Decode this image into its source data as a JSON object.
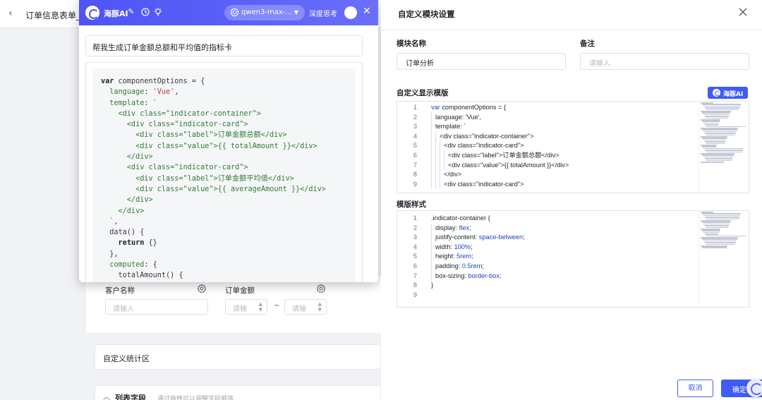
{
  "background": {
    "back_icon": "chevron-left-icon",
    "title": "订单信息表单_o",
    "fields": [
      {
        "label": "客户名称",
        "placeholder": "请输入"
      },
      {
        "label": "订单金额",
        "min_placeholder": "请输",
        "max_placeholder": "请输",
        "separator": "~"
      }
    ],
    "stats_section_title": "自定义统计区",
    "list_section_title": "列表字段",
    "list_section_hint": "通过拖拽可以调整字段顺序"
  },
  "ai_panel": {
    "name": "海豚AI",
    "header_icons": [
      "magic-wand-icon",
      "history-icon",
      "lightbulb-icon"
    ],
    "model": "qwen3-max-...",
    "deep_think_label": "深度思考",
    "prompt": "帮我生成订单金额总额和平均值的指标卡",
    "code_lines": [
      [
        {
          "t": "var",
          "c": "ck"
        },
        {
          "t": " componentOptions = {"
        }
      ],
      [
        {
          "t": "  "
        },
        {
          "t": "language",
          "c": "cp"
        },
        {
          "t": ": "
        },
        {
          "t": "'Vue'",
          "c": "cs"
        },
        {
          "t": ","
        }
      ],
      [
        {
          "t": "  "
        },
        {
          "t": "template",
          "c": "cp"
        },
        {
          "t": ": `"
        }
      ],
      [
        {
          "t": "    <div class=\"indicator-container\">",
          "c": "cp"
        }
      ],
      [
        {
          "t": "      <div class=\"indicator-card\">",
          "c": "cp"
        }
      ],
      [
        {
          "t": "        <div class=\"label\">订单金额总额</div>",
          "c": "cp"
        }
      ],
      [
        {
          "t": "        <div class=\"value\">{{ totalAmount }}</div>",
          "c": "cp"
        }
      ],
      [
        {
          "t": "      </div>",
          "c": "cp"
        }
      ],
      [
        {
          "t": "      <div class=\"indicator-card\">",
          "c": "cp"
        }
      ],
      [
        {
          "t": "        <div class=\"label\">订单金额平均值</div>",
          "c": "cp"
        }
      ],
      [
        {
          "t": "        <div class=\"value\">{{ averageAmount }}</div>",
          "c": "cp"
        }
      ],
      [
        {
          "t": "      </div>",
          "c": "cp"
        }
      ],
      [
        {
          "t": "    </div>",
          "c": "cp"
        }
      ],
      [
        {
          "t": "  `",
          "c": "cp"
        },
        {
          "t": ","
        }
      ],
      [
        {
          "t": "  data() {"
        }
      ],
      [
        {
          "t": "    "
        },
        {
          "t": "return",
          "c": "ck"
        },
        {
          "t": " {}"
        }
      ],
      [
        {
          "t": "  },"
        }
      ],
      [
        {
          "t": "  "
        },
        {
          "t": "computed",
          "c": "cp"
        },
        {
          "t": ": {"
        }
      ],
      [
        {
          "t": "    totalAmount() {"
        }
      ]
    ]
  },
  "settings": {
    "title": "自定义模块设置",
    "module_name_label": "模块名称",
    "module_name_value": "订单分析",
    "remark_label": "备注",
    "remark_placeholder": "请输入",
    "template_label": "自定义显示模版",
    "ai_button_label": "海豚AI",
    "style_label": "模版样式",
    "template_lines": [
      {
        "n": "1",
        "indent": 0,
        "parts": [
          {
            "t": "var",
            "c": "ks"
          },
          {
            "t": " componentOptions = {"
          }
        ]
      },
      {
        "n": "2",
        "indent": 1,
        "parts": [
          {
            "t": "language: 'Vue',"
          }
        ]
      },
      {
        "n": "3",
        "indent": 1,
        "parts": [
          {
            "t": "template: `"
          }
        ]
      },
      {
        "n": "4",
        "indent": 2,
        "parts": [
          {
            "t": "<div class=\"indicator-container\">"
          }
        ]
      },
      {
        "n": "5",
        "indent": 3,
        "parts": [
          {
            "t": "<div class=\"indicator-card\">"
          }
        ]
      },
      {
        "n": "6",
        "indent": 4,
        "parts": [
          {
            "t": "<div class=\"label\">订单金额总额</div>"
          }
        ]
      },
      {
        "n": "7",
        "indent": 4,
        "parts": [
          {
            "t": "<div class=\"value\">{{ totalAmount }}</div>"
          }
        ]
      },
      {
        "n": "8",
        "indent": 3,
        "parts": [
          {
            "t": "</div>"
          }
        ]
      },
      {
        "n": "9",
        "indent": 3,
        "parts": [
          {
            "t": "<div class=\"indicator-card\">"
          }
        ]
      }
    ],
    "style_lines": [
      {
        "n": "1",
        "indent": 0,
        "parts": [
          {
            "t": ".indicator-container {"
          }
        ]
      },
      {
        "n": "2",
        "indent": 1,
        "parts": [
          {
            "t": "display"
          },
          {
            "t": ": "
          },
          {
            "t": "flex",
            "c": "vs"
          },
          {
            "t": ";"
          }
        ]
      },
      {
        "n": "3",
        "indent": 1,
        "parts": [
          {
            "t": "justify-content"
          },
          {
            "t": ": "
          },
          {
            "t": "space-between",
            "c": "vs"
          },
          {
            "t": ";"
          }
        ]
      },
      {
        "n": "4",
        "indent": 1,
        "parts": [
          {
            "t": "width"
          },
          {
            "t": ": "
          },
          {
            "t": "100%",
            "c": "vs"
          },
          {
            "t": ";"
          }
        ]
      },
      {
        "n": "5",
        "indent": 1,
        "parts": [
          {
            "t": "height"
          },
          {
            "t": ": "
          },
          {
            "t": "5rem",
            "c": "vs"
          },
          {
            "t": ";"
          }
        ]
      },
      {
        "n": "6",
        "indent": 1,
        "parts": [
          {
            "t": "padding"
          },
          {
            "t": ": "
          },
          {
            "t": "0.5rem",
            "c": "vs"
          },
          {
            "t": ";"
          }
        ]
      },
      {
        "n": "7",
        "indent": 1,
        "parts": [
          {
            "t": "box-sizing"
          },
          {
            "t": ": "
          },
          {
            "t": "border-box",
            "c": "vs"
          },
          {
            "t": ";"
          }
        ]
      },
      {
        "n": "8",
        "indent": 0,
        "parts": [
          {
            "t": "}"
          }
        ]
      },
      {
        "n": "9",
        "indent": 0,
        "parts": []
      }
    ],
    "cancel_label": "取消",
    "confirm_label": "确定"
  },
  "colors": {
    "primary": "#3f5cf5",
    "ai_header": "#4e54f6",
    "code_string": "#b8442c",
    "code_property": "#2f7d32"
  }
}
